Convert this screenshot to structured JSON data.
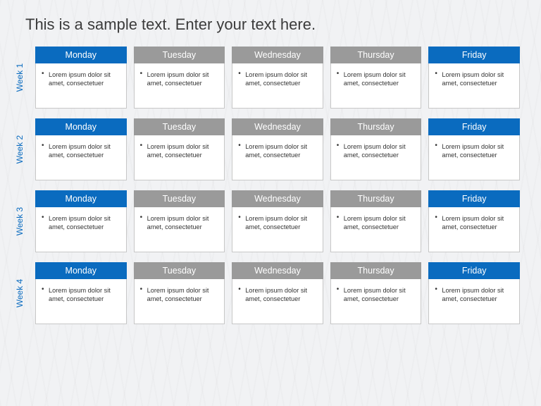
{
  "title": "This is a sample text. Enter your text here.",
  "days": [
    "Monday",
    "Tuesday",
    "Wednesday",
    "Thursday",
    "Friday"
  ],
  "dayColors": [
    "blue",
    "gray",
    "gray",
    "gray",
    "blue"
  ],
  "weeks": [
    {
      "label": "Week 1",
      "cells": [
        "Lorem ipsum dolor sit amet, consectetuer",
        "Lorem ipsum dolor sit amet, consectetuer",
        "Lorem ipsum dolor sit amet, consectetuer",
        "Lorem ipsum dolor sit amet, consectetuer",
        "Lorem ipsum dolor sit amet, consectetuer"
      ]
    },
    {
      "label": "Week 2",
      "cells": [
        "Lorem ipsum dolor sit amet, consectetuer",
        "Lorem ipsum dolor sit amet, consectetuer",
        "Lorem ipsum dolor sit amet, consectetuer",
        "Lorem ipsum dolor sit amet, consectetuer",
        "Lorem ipsum dolor sit amet, consectetuer"
      ]
    },
    {
      "label": "Week 3",
      "cells": [
        "Lorem ipsum dolor sit amet, consectetuer",
        "Lorem ipsum dolor sit amet, consectetuer",
        "Lorem ipsum dolor sit amet, consectetuer",
        "Lorem ipsum dolor sit amet, consectetuer",
        "Lorem ipsum dolor sit amet, consectetuer"
      ]
    },
    {
      "label": "Week 4",
      "cells": [
        "Lorem ipsum dolor sit amet, consectetuer",
        "Lorem ipsum dolor sit amet, consectetuer",
        "Lorem ipsum dolor sit amet, consectetuer",
        "Lorem ipsum dolor sit amet, consectetuer",
        "Lorem ipsum dolor sit amet, consectetuer"
      ]
    }
  ]
}
